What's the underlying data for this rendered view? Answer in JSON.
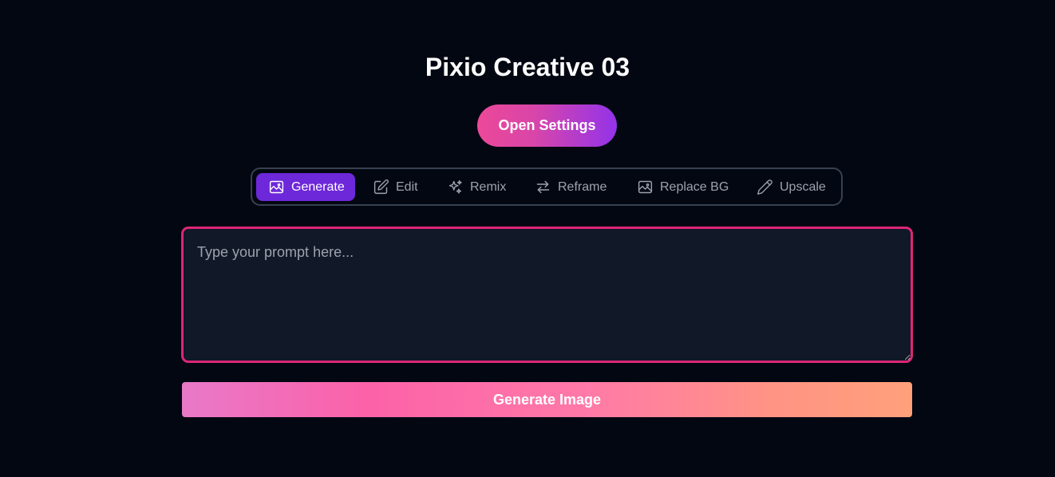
{
  "header": {
    "title": "Pixio Creative 03"
  },
  "settings_button": {
    "label": "Open Settings"
  },
  "tabs": [
    {
      "label": "Generate",
      "icon": "image-icon",
      "active": true
    },
    {
      "label": "Edit",
      "icon": "pencil-square-icon",
      "active": false
    },
    {
      "label": "Remix",
      "icon": "sparkles-icon",
      "active": false
    },
    {
      "label": "Reframe",
      "icon": "arrows-swap-icon",
      "active": false
    },
    {
      "label": "Replace BG",
      "icon": "image-icon",
      "active": false
    },
    {
      "label": "Upscale",
      "icon": "pencil-icon",
      "active": false
    }
  ],
  "prompt": {
    "value": "",
    "placeholder": "Type your prompt here..."
  },
  "generate_button": {
    "label": "Generate Image"
  },
  "colors": {
    "background": "#030712",
    "active_tab": "#6d28d9",
    "prompt_border": "#db2777",
    "prompt_background": "#111827"
  }
}
